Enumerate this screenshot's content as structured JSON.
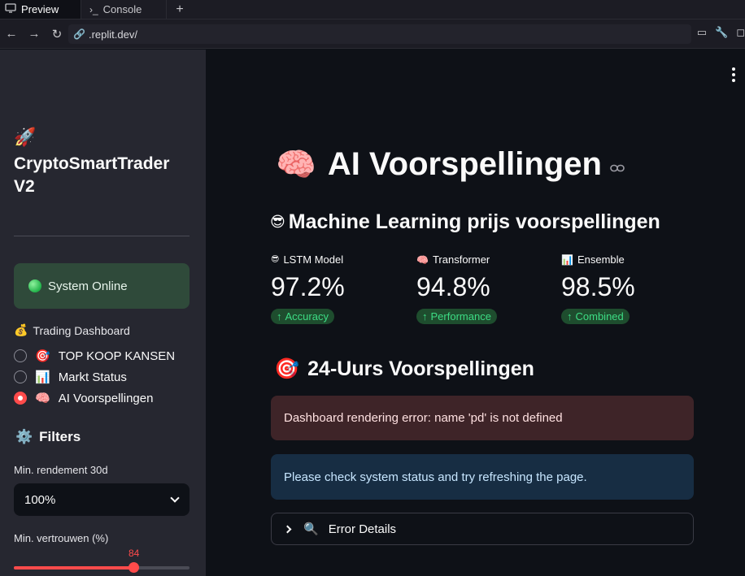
{
  "browser": {
    "tabs": [
      {
        "label": "Preview",
        "icon": "monitor-icon",
        "active": true
      },
      {
        "label": "Console",
        "icon": "terminal-icon",
        "active": false
      }
    ],
    "add_tab": "+",
    "url": ".replit.dev/"
  },
  "sidebar": {
    "rocket_emoji": "🚀",
    "title": "CryptoSmartTrader V2",
    "status": {
      "label": "System Online",
      "color": "#2f4a3a"
    },
    "nav_heading": {
      "emoji": "💰",
      "label": "Trading Dashboard"
    },
    "nav_items": [
      {
        "emoji": "🎯",
        "label": "TOP KOOP KANSEN",
        "selected": false
      },
      {
        "emoji": "📊",
        "label": "Markt Status",
        "selected": false
      },
      {
        "emoji": "🧠",
        "label": "AI Voorspellingen",
        "selected": true
      }
    ],
    "filters": {
      "emoji": "⚙️",
      "title": "Filters",
      "min_return_label": "Min. rendement 30d",
      "min_return_value": "100%",
      "min_confidence_label": "Min. vertrouwen (%)",
      "min_confidence_value": "84",
      "slider_fraction": 0.68
    }
  },
  "main": {
    "title_emoji": "🧠",
    "title": "AI Voorspellingen",
    "subtitle_emoji": "😎",
    "subtitle": "Machine Learning prijs voorspellingen",
    "metrics": [
      {
        "emoji": "😎",
        "label": "LSTM Model",
        "value": "97.2%",
        "delta": "Accuracy"
      },
      {
        "emoji": "🧠",
        "label": "Transformer",
        "value": "94.8%",
        "delta": "Performance"
      },
      {
        "emoji": "📊",
        "label": "Ensemble",
        "value": "98.5%",
        "delta": "Combined"
      }
    ],
    "section_emoji": "🎯",
    "section_title": "24-Uurs Voorspellingen",
    "error_message": "Dashboard rendering error: name 'pd' is not defined",
    "info_message": "Please check system status and try refreshing the page.",
    "expander": {
      "emoji": "🔍",
      "label": "Error Details"
    }
  },
  "colors": {
    "accent": "#ff4b4b",
    "success": "#3ddc84",
    "error_bg": "#3e2428",
    "info_bg": "#172d43"
  }
}
